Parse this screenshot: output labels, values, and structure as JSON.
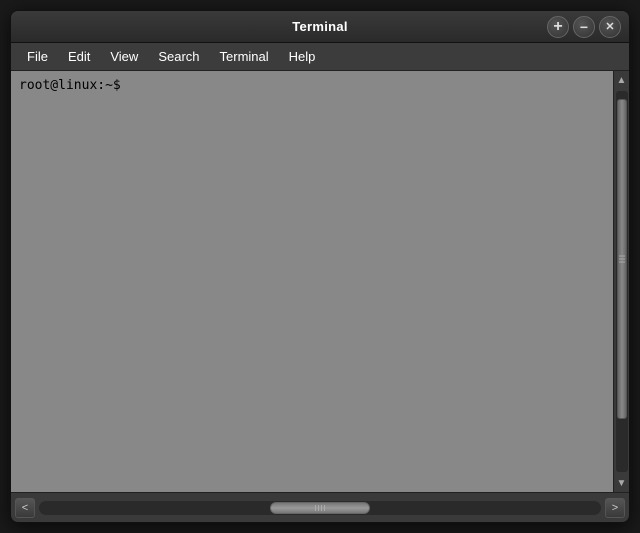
{
  "titlebar": {
    "title": "Terminal",
    "btn_add": "+",
    "btn_minimize": "−",
    "btn_close": "✕"
  },
  "menubar": {
    "items": [
      {
        "id": "file",
        "label": "File"
      },
      {
        "id": "edit",
        "label": "Edit"
      },
      {
        "id": "view",
        "label": "View"
      },
      {
        "id": "search",
        "label": "Search"
      },
      {
        "id": "terminal",
        "label": "Terminal"
      },
      {
        "id": "help",
        "label": "Help"
      }
    ]
  },
  "terminal": {
    "prompt": "root@linux:~$"
  },
  "scrollbar": {
    "up_arrow": "▲",
    "down_arrow": "▼",
    "left_arrow": "<",
    "right_arrow": ">"
  }
}
